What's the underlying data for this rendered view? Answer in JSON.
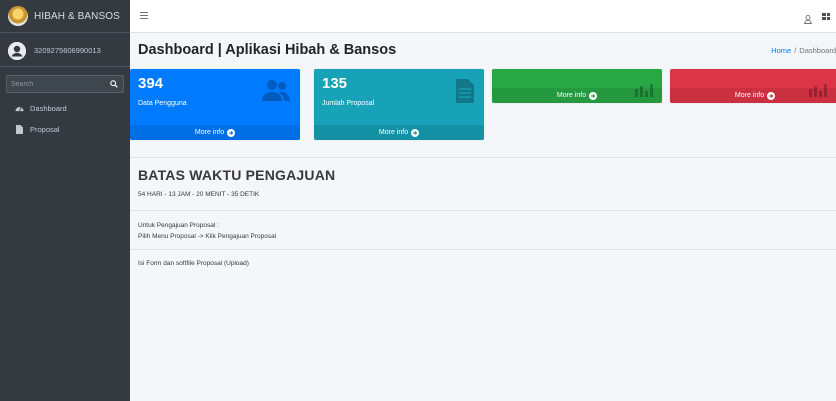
{
  "brand": {
    "title": "HIBAH & BANSOS"
  },
  "user": {
    "id": "3209275606990013"
  },
  "search": {
    "placeholder": "Search"
  },
  "sidebar": {
    "items": [
      {
        "label": "Dashboard",
        "icon": "tachometer-icon"
      },
      {
        "label": "Proposal",
        "icon": "file-icon"
      }
    ]
  },
  "header": {
    "title": "Dashboard | Aplikasi Hibah & Bansos",
    "breadcrumb": {
      "home": "Home",
      "separator": "/",
      "current": "Dashboard"
    }
  },
  "stats": [
    {
      "value": "394",
      "label": "Data Pengguna",
      "more": "More info",
      "color": "#007bff",
      "icon": "users-icon"
    },
    {
      "value": "135",
      "label": "Jumlah Proposal",
      "more": "More info",
      "color": "#17a2b8",
      "icon": "document-icon"
    },
    {
      "value": "",
      "label": "",
      "more": "More info",
      "color": "#28a745",
      "icon": "chart-icon"
    },
    {
      "value": "",
      "label": "",
      "more": "More info",
      "color": "#dc3545",
      "icon": "chart-icon"
    }
  ],
  "deadline": {
    "title": "BATAS WAKTU PENGAJUAN",
    "countdown": "54 HARI - 13 JAM - 20 MENIT - 35 DETIK"
  },
  "info": {
    "line1": "Untuk Pengajuan Proposal :",
    "line2": "Pilih Menu Proposal -> Klik Pengajuan Proposal",
    "line3": "Isi Form dan softfile Proposal (Upload)"
  }
}
